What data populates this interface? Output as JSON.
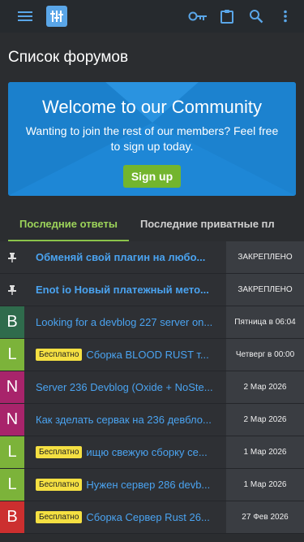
{
  "page": {
    "title": "Список форумов"
  },
  "colors": {
    "topbar": "#262a2e",
    "accent_blue": "#1e87d6",
    "accent_green": "#73b52e",
    "link": "#4aa3f0",
    "badge": "#f5e042"
  },
  "topbar": {
    "icons": [
      "menu-icon",
      "logo-icon",
      "key-icon",
      "clipboard-icon",
      "search-icon",
      "more-vertical-icon"
    ]
  },
  "banner": {
    "title": "Welcome to our Community",
    "text": "Wanting to join the rest of our members? Feel free to sign up today.",
    "signup_label": "Sign up"
  },
  "tabs": [
    {
      "label": "Последние ответы",
      "active": true
    },
    {
      "label": "Последние приватные пл",
      "active": false
    }
  ],
  "threads": [
    {
      "avatar_letter": "",
      "avatar_color": "#2e3034",
      "pinned": true,
      "badge": "",
      "title": "Обменяй свой плагин на любо...",
      "bold": true,
      "meta": "ЗАКРЕПЛЕНО"
    },
    {
      "avatar_letter": "",
      "avatar_color": "#2e3034",
      "pinned": true,
      "badge": "",
      "title": "Enot io Новый платежный мето...",
      "bold": true,
      "meta": "ЗАКРЕПЛЕНО"
    },
    {
      "avatar_letter": "B",
      "avatar_color": "#2f6b4c",
      "pinned": false,
      "badge": "",
      "title": "Looking for a devblog 227 server on...",
      "bold": false,
      "meta": "Пятница в 06:04"
    },
    {
      "avatar_letter": "L",
      "avatar_color": "#7cb33a",
      "pinned": false,
      "badge": "Бесплатно",
      "title": "Сборка BLOOD RUST т...",
      "bold": false,
      "meta": "Четверг в 00:00"
    },
    {
      "avatar_letter": "N",
      "avatar_color": "#a8246b",
      "pinned": false,
      "badge": "",
      "title": "Server 236 Devblog (Oxide + NoSte...",
      "bold": false,
      "meta": "2 Мар 2026"
    },
    {
      "avatar_letter": "N",
      "avatar_color": "#a8246b",
      "pinned": false,
      "badge": "",
      "title": "Как зделать сервак на 236 девбло...",
      "bold": false,
      "meta": "2 Мар 2026"
    },
    {
      "avatar_letter": "L",
      "avatar_color": "#7cb33a",
      "pinned": false,
      "badge": "Бесплатно",
      "title": "ищю свежую сборку се...",
      "bold": false,
      "meta": "1 Мар 2026"
    },
    {
      "avatar_letter": "L",
      "avatar_color": "#7cb33a",
      "pinned": false,
      "badge": "Бесплатно",
      "title": "Нужен сервер 286 devb...",
      "bold": false,
      "meta": "1 Мар 2026"
    },
    {
      "avatar_letter": "B",
      "avatar_color": "#cc2f2f",
      "pinned": false,
      "badge": "Бесплатно",
      "title": "Сборка Сервер Rust 26...",
      "bold": false,
      "meta": "27 Фев 2026"
    }
  ]
}
